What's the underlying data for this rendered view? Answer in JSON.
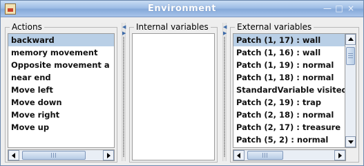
{
  "window": {
    "title": "Environment",
    "controls": {
      "minimize": "—",
      "maximize": "□",
      "close": "×"
    }
  },
  "panels": {
    "actions": {
      "title": "Actions",
      "items": [
        {
          "label": "backward",
          "selected": true
        },
        {
          "label": "memory movement",
          "selected": false
        },
        {
          "label": "Opposite movement a",
          "selected": false
        },
        {
          "label": "near end",
          "selected": false
        },
        {
          "label": "Move left",
          "selected": false
        },
        {
          "label": "Move down",
          "selected": false
        },
        {
          "label": "Move right",
          "selected": false
        },
        {
          "label": "Move up",
          "selected": false
        }
      ]
    },
    "internal": {
      "title": "Internal variables",
      "items": []
    },
    "external": {
      "title": "External variables",
      "items": [
        {
          "label": "Patch (1, 17) : wall",
          "selected": true
        },
        {
          "label": "Patch (1, 16) : wall",
          "selected": false
        },
        {
          "label": "Patch (1, 19) : normal",
          "selected": false
        },
        {
          "label": "Patch (1, 18) : normal",
          "selected": false
        },
        {
          "label": "StandardVariable visited",
          "selected": false
        },
        {
          "label": "Patch (2, 19) : trap",
          "selected": false
        },
        {
          "label": "Patch (2, 18) : normal",
          "selected": false
        },
        {
          "label": "Patch (2, 17) : treasure",
          "selected": false
        },
        {
          "label": "Patch (5, 2) : normal",
          "selected": false
        }
      ]
    }
  },
  "colors": {
    "selection": "#b9cfe6",
    "titlebar": "#9ebde6"
  }
}
